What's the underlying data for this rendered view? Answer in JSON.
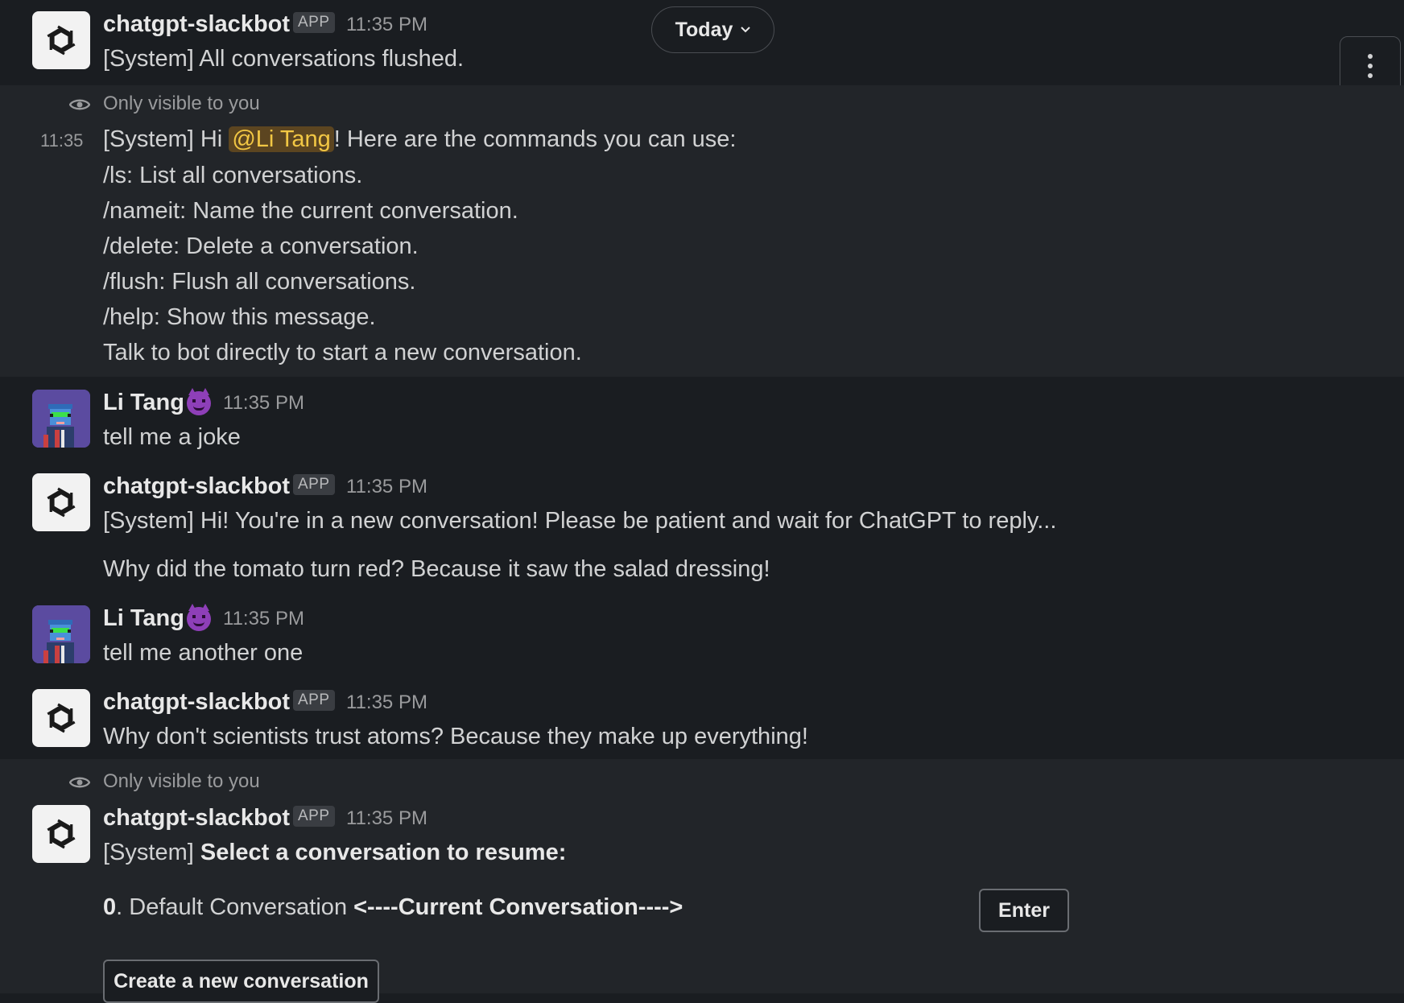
{
  "date_divider": {
    "label": "Today"
  },
  "messages": [
    {
      "sender": "chatgpt-slackbot",
      "badge": "APP",
      "time": "11:35 PM",
      "text": "[System] All conversations flushed."
    },
    {
      "ephemeral_label": "Only visible to you",
      "hover_time": "11:35",
      "lines": {
        "l1_pre": "[System] Hi ",
        "l1_mention": "@Li Tang",
        "l1_post": "! Here are the commands you can use:",
        "l2": "/ls: List all conversations.",
        "l3": "/nameit: Name the current conversation.",
        "l4": "/delete: Delete a conversation.",
        "l5": "/flush: Flush all conversations.",
        "l6": "/help: Show this message.",
        "l7": "Talk to bot directly to start a new conversation."
      }
    },
    {
      "sender": "Li Tang",
      "time": "11:35 PM",
      "text": "tell me a joke"
    },
    {
      "sender": "chatgpt-slackbot",
      "badge": "APP",
      "time": "11:35 PM",
      "text": "[System] Hi! You're in a new conversation! Please be patient and wait for ChatGPT to reply...",
      "text2": "Why did the tomato turn red? Because it saw the salad dressing!"
    },
    {
      "sender": "Li Tang",
      "time": "11:35 PM",
      "text": "tell me another one"
    },
    {
      "sender": "chatgpt-slackbot",
      "badge": "APP",
      "time": "11:35 PM",
      "text": "Why don't scientists trust atoms? Because they make up everything!"
    },
    {
      "ephemeral_label": "Only visible to you",
      "sender": "chatgpt-slackbot",
      "badge": "APP",
      "time": "11:35 PM",
      "text_pre": "[System] ",
      "text_bold": "Select a conversation to resume:",
      "option_index": "0",
      "option_text": ". Default Conversation ",
      "option_current": "<----Current Conversation---->",
      "enter_label": "Enter",
      "create_label": "Create a new conversation"
    }
  ],
  "icons": {
    "bot_avatar": "openai-logo-icon",
    "user_avatar": "pixel-character-avatar",
    "user_emoji": "smiling-imp-emoji",
    "ephemeral": "eye-icon",
    "more": "vertical-ellipsis-icon",
    "date_chevron": "chevron-down-icon"
  },
  "colors": {
    "background": "#1a1d21",
    "ephemeral_background": "#222529",
    "mention_background": "#5c4520",
    "mention_text": "#f2c744"
  }
}
